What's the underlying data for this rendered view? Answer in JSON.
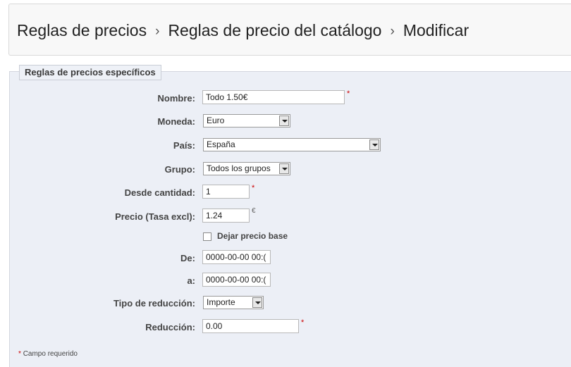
{
  "breadcrumb": {
    "items": [
      "Reglas de precios",
      "Reglas de precio del catálogo",
      "Modificar"
    ],
    "separator": "›"
  },
  "form": {
    "legend": "Reglas de precios específicos",
    "nombre": {
      "label": "Nombre:",
      "value": "Todo 1.50€"
    },
    "moneda": {
      "label": "Moneda:",
      "value": "Euro"
    },
    "pais": {
      "label": "País:",
      "value": "España"
    },
    "grupo": {
      "label": "Grupo:",
      "value": "Todos los grupos"
    },
    "desde_cantidad": {
      "label": "Desde cantidad:",
      "value": "1"
    },
    "precio": {
      "label": "Precio (Tasa excl):",
      "value": "1.24",
      "unit": "€"
    },
    "dejar_precio_base": {
      "label": "Dejar precio base",
      "checked": false
    },
    "de": {
      "label": "De:",
      "value": "0000-00-00 00:("
    },
    "a": {
      "label": "a:",
      "value": "0000-00-00 00:("
    },
    "tipo_reduccion": {
      "label": "Tipo de reducción:",
      "value": "Importe"
    },
    "reduccion": {
      "label": "Reducción:",
      "value": "0.00"
    },
    "required_mark": "*"
  },
  "footer": {
    "required_note": "Campo requerido",
    "star": "*"
  },
  "colors": {
    "required": "#cc0000",
    "panel_bg": "#eceff6",
    "header_bg": "#f8f8f8"
  }
}
